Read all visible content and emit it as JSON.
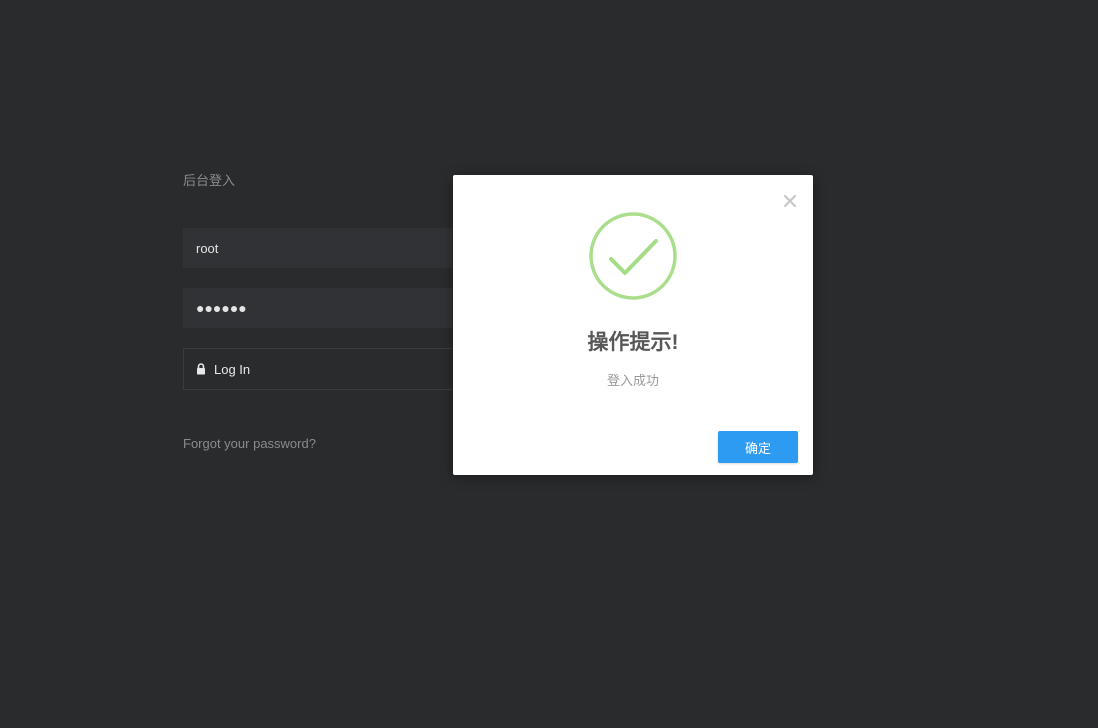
{
  "login": {
    "title": "后台登入",
    "username_value": "root",
    "password_value": "●●●●●●",
    "login_button_label": "Log In",
    "forgot_link": "Forgot your password?"
  },
  "dialog": {
    "title": "操作提示!",
    "message": "登入成功",
    "confirm_label": "确定",
    "icon": "success-check-icon",
    "accent_color": "#a5dc86"
  }
}
